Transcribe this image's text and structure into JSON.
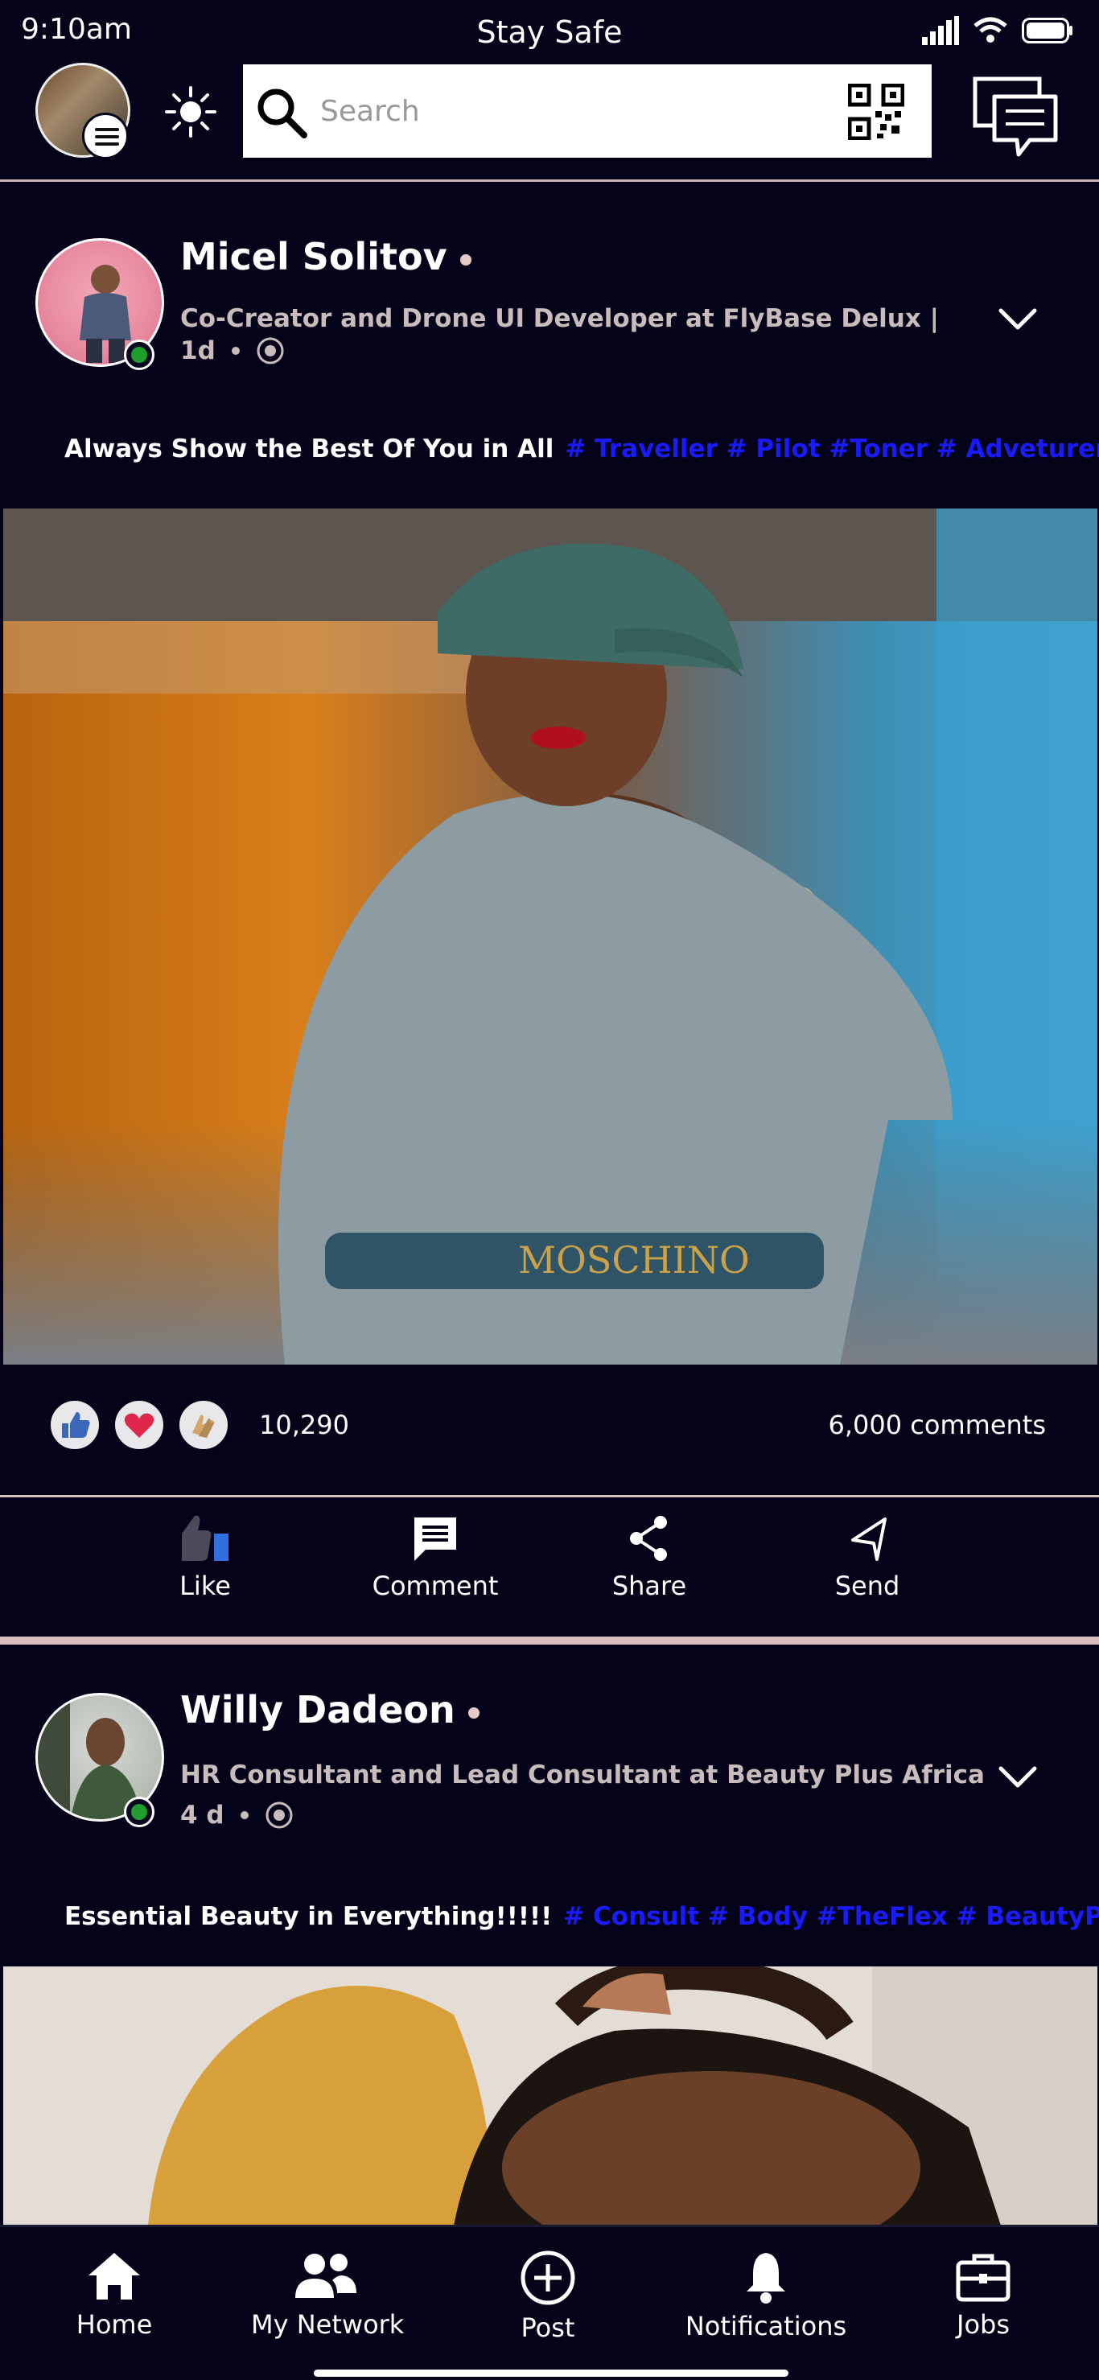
{
  "status_bar": {
    "time": "9:10am",
    "center": "Stay  Safe",
    "icons": [
      "signal-icon",
      "wifi-icon",
      "battery-icon"
    ]
  },
  "header": {
    "search_placeholder": "Search",
    "icons": [
      "avatar",
      "menu-icon",
      "sun-icon",
      "search-icon",
      "qr-code-icon",
      "chat-icon"
    ]
  },
  "posts": [
    {
      "name": "Micel  Solitov",
      "headline": "Co-Creator and Drone UI Developer at FlyBase Delux  |",
      "time": "1d",
      "caption": "Always Show the Best Of You in All",
      "tags": "# Traveller # Pilot #Toner # Adveturer",
      "reaction_count": "10,290",
      "comments": "6,000 comments"
    },
    {
      "name": "Willy Dadeon",
      "headline": "HR Consultant and Lead Consultant at Beauty Plus Africa",
      "time": "4 d",
      "caption": "Essential Beauty in Everything!!!!!",
      "tags": "# Consult # Body #TheFlex # BeautyPlus"
    }
  ],
  "actions": {
    "like": "Like",
    "comment": "Comment",
    "share": "Share",
    "send": "Send"
  },
  "nav": {
    "home": "Home",
    "network": "My Network",
    "post": "Post",
    "notifications": "Notifications",
    "jobs": "Jobs"
  },
  "colors": {
    "background": "#04031a",
    "hashtag": "#1a1aff",
    "online": "#1f9e2e",
    "divider": "#d8c2c2"
  }
}
